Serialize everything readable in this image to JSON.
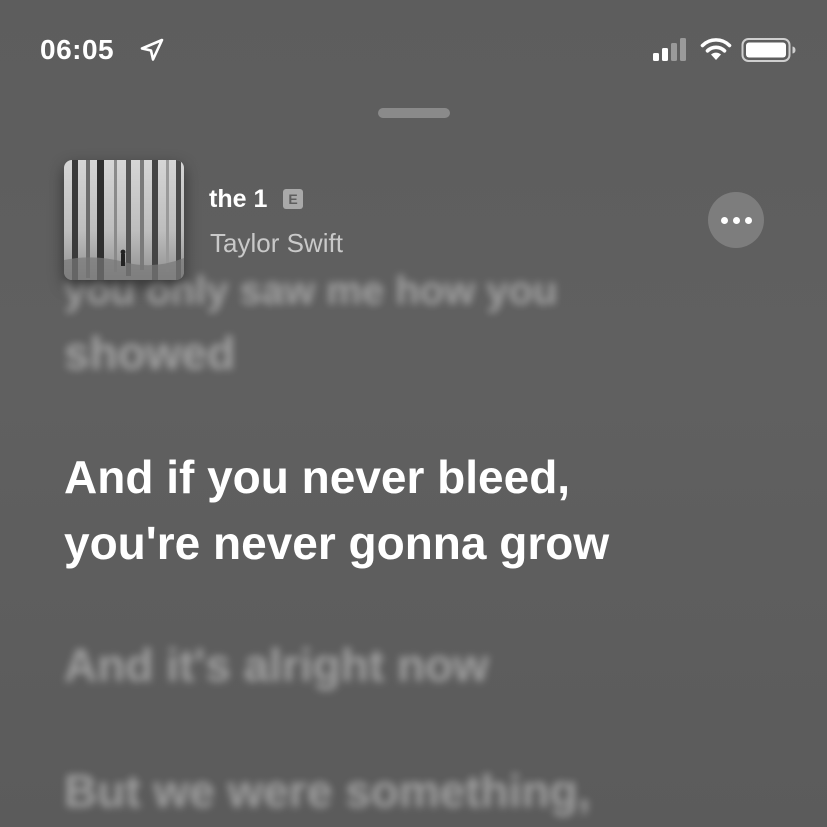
{
  "status_bar": {
    "time": "06:05",
    "icons": [
      "location-arrow-icon",
      "cellular-signal-icon",
      "wifi-icon",
      "battery-icon"
    ]
  },
  "now_playing": {
    "title": "the 1",
    "explicit_badge": "E",
    "artist": "Taylor Swift",
    "artwork": "album-artwork"
  },
  "more_button": {
    "icon": "ellipsis-icon"
  },
  "lyrics": {
    "previous_partial": "you only saw me how you",
    "previous": "showed",
    "current_line_1": "And if you never bleed,",
    "current_line_2": "you're never gonna grow",
    "next_1": "And it's alright now",
    "next_2": "But we were something,"
  },
  "colors": {
    "background": "#5e5e5e",
    "current_lyric": "#ffffff",
    "dim_lyric": "rgba(255,255,255,0.42)",
    "artist": "#c9c9c9",
    "more_button_bg": "#7d7d7d"
  }
}
